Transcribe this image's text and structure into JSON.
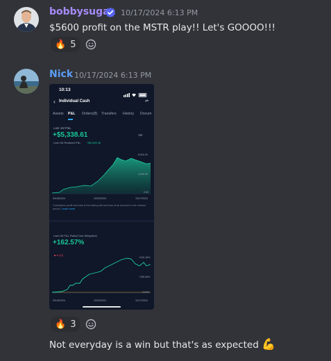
{
  "messages": [
    {
      "username": "bobbysugar",
      "timestamp": "10/17/2024 6:13 PM",
      "text": "$5600 profit on the MSTR play!!  Let's GOOOO!!!",
      "reaction": {
        "emoji": "🔥",
        "count": "5"
      },
      "user_color": "#a78bfa"
    },
    {
      "username": "Nick",
      "timestamp": "10/17/2024 6:13 PM",
      "reaction": {
        "emoji": "🔥",
        "count": "3"
      },
      "text": "Not everyday is a win but that's as expected",
      "text_emoji": "💪",
      "user_color": "#5b9cf5"
    }
  ],
  "attachment": {
    "time": "10:13",
    "title": "Individual Cash",
    "tabs": [
      "Assets",
      "P&L",
      "Orders(8)",
      "Transfers",
      "History",
      "Docum"
    ],
    "active_tab": "P&L",
    "pnl_label": "Last 1M P&L",
    "pnl_value": "+$5,338.61",
    "pnl_period": "1M",
    "realized_label": "Last 1M Realized P&L",
    "realized_value": "+$6,028.36",
    "chart1_y_labels": [
      "8,000.00",
      "4,000.00",
      "0.00"
    ],
    "chart1_x_labels": [
      "09/18/2024",
      "10/03/2024",
      "10/17/2024"
    ],
    "note_text": "Cumulative profit and loss is the total profit and loss of an account in the chosen period.",
    "note_link": "Learn more",
    "pct_label": "Last 1M P&L Ratio(Time-Weighted)",
    "pct_value": "+162.57%",
    "chart2_legend": "■ ● QQ",
    "chart2_y_labels": [
      "+310.16%",
      "+155.08%",
      "0.00%"
    ],
    "chart2_x_labels": [
      "09/18/2024",
      "10/03/2024",
      "10/17/2024"
    ]
  },
  "colors": {
    "background": "#313338",
    "green": "#19c797",
    "username_bobby": "#a78bfa",
    "username_nick": "#5b9cf5"
  },
  "icons": [
    "verified-badge-icon",
    "fire-emoji",
    "add-reaction-icon",
    "flexed-biceps-emoji"
  ]
}
